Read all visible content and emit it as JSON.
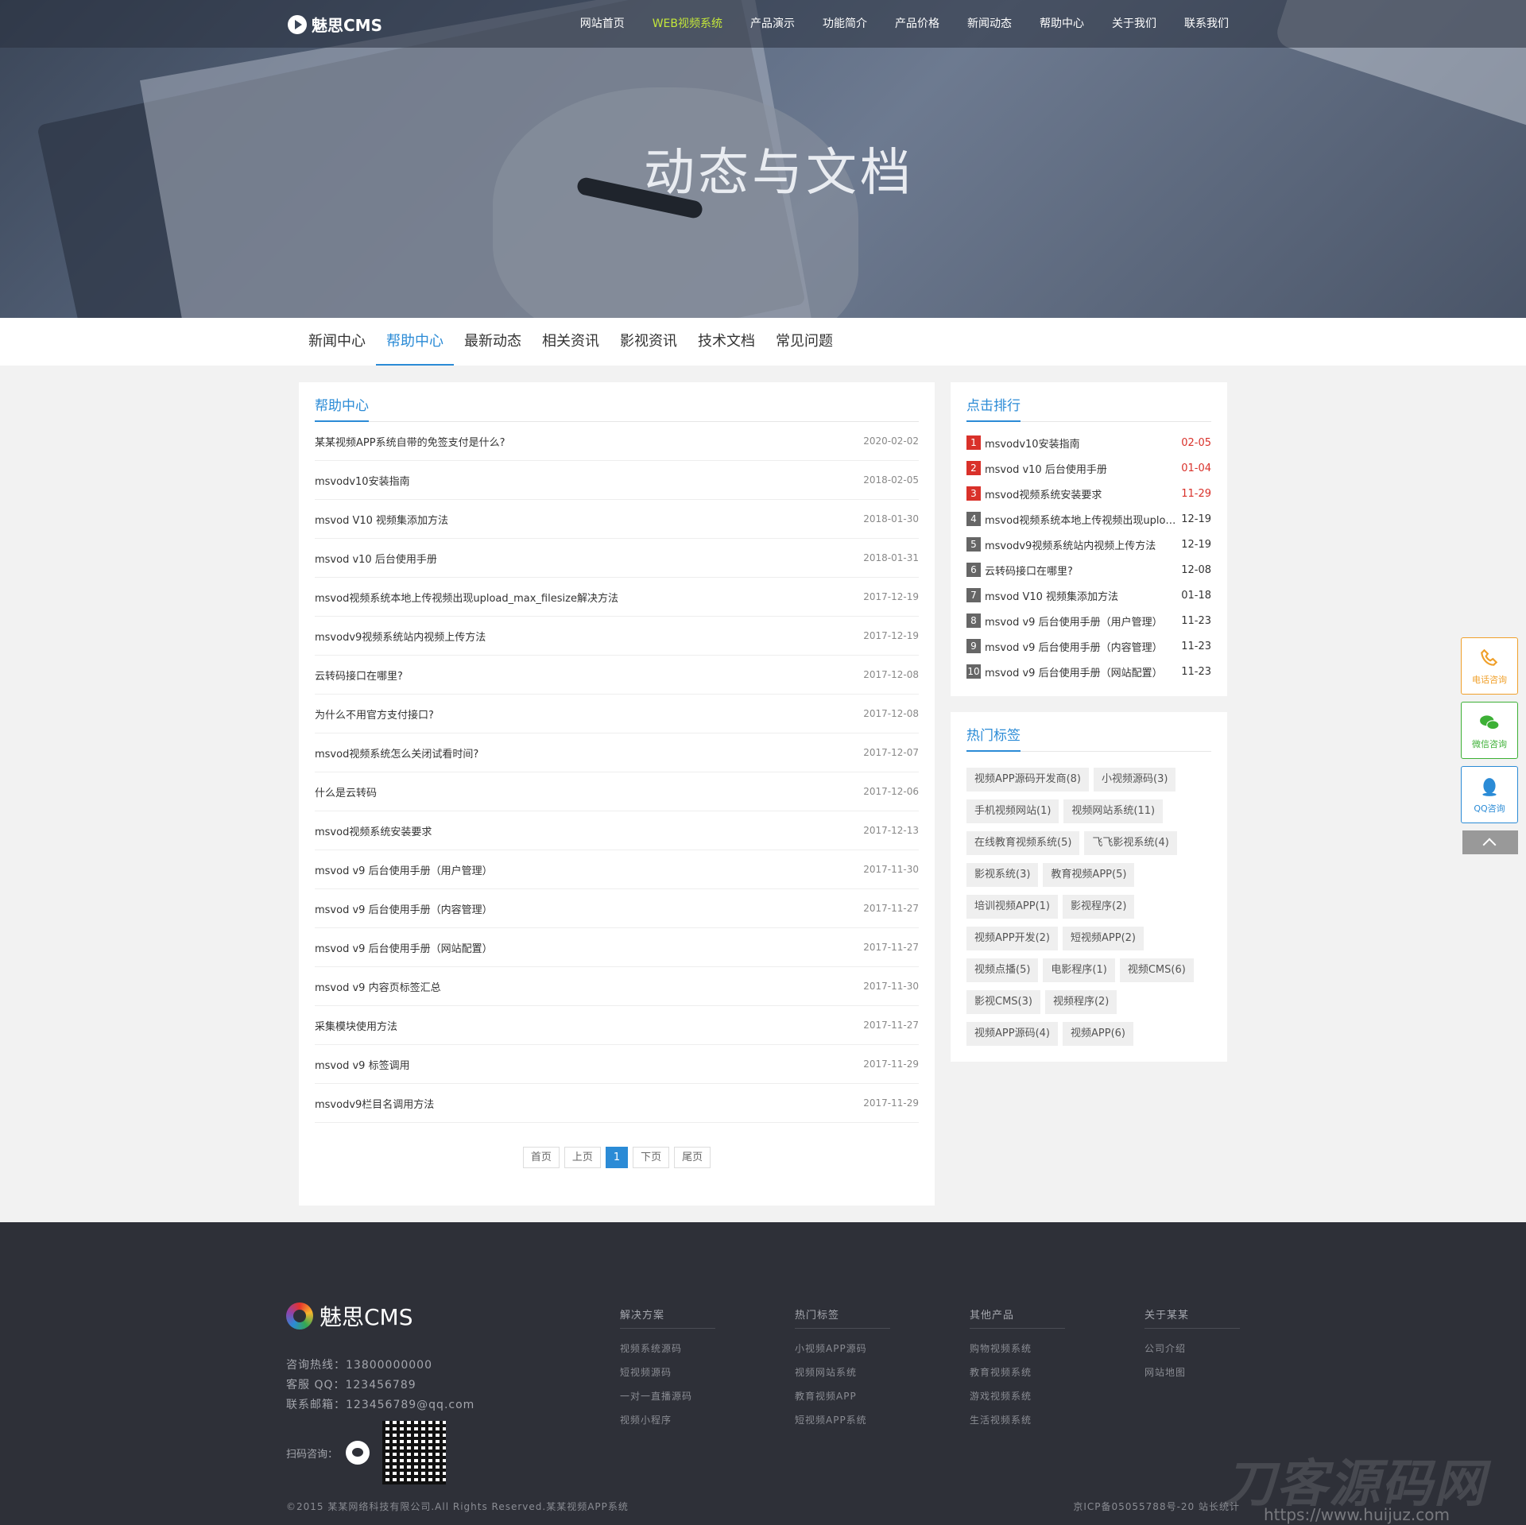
{
  "header": {
    "logo": "魅思CMS",
    "nav": [
      {
        "label": "网站首页",
        "active": false
      },
      {
        "label": "WEB视频系统",
        "active": true
      },
      {
        "label": "产品演示",
        "active": false
      },
      {
        "label": "功能简介",
        "active": false
      },
      {
        "label": "产品价格",
        "active": false
      },
      {
        "label": "新闻动态",
        "active": false
      },
      {
        "label": "帮助中心",
        "active": false
      },
      {
        "label": "关于我们",
        "active": false
      },
      {
        "label": "联系我们",
        "active": false
      }
    ],
    "banner_title": "动态与文档"
  },
  "tabs": [
    {
      "label": "新闻中心",
      "active": false
    },
    {
      "label": "帮助中心",
      "active": true
    },
    {
      "label": "最新动态",
      "active": false
    },
    {
      "label": "相关资讯",
      "active": false
    },
    {
      "label": "影视资讯",
      "active": false
    },
    {
      "label": "技术文档",
      "active": false
    },
    {
      "label": "常见问题",
      "active": false
    }
  ],
  "main": {
    "title": "帮助中心",
    "items": [
      {
        "title": "某某视频APP系统自带的免签支付是什么?",
        "date": "2020-02-02"
      },
      {
        "title": "msvodv10安装指南",
        "date": "2018-02-05"
      },
      {
        "title": "msvod V10 视频集添加方法",
        "date": "2018-01-30"
      },
      {
        "title": "msvod v10 后台使用手册",
        "date": "2018-01-31"
      },
      {
        "title": "msvod视频系统本地上传视频出现upload_max_filesize解决方法",
        "date": "2017-12-19"
      },
      {
        "title": "msvodv9视频系统站内视频上传方法",
        "date": "2017-12-19"
      },
      {
        "title": "云转码接口在哪里?",
        "date": "2017-12-08"
      },
      {
        "title": "为什么不用官方支付接口?",
        "date": "2017-12-08"
      },
      {
        "title": "msvod视频系统怎么关闭试看时间?",
        "date": "2017-12-07"
      },
      {
        "title": "什么是云转码",
        "date": "2017-12-06"
      },
      {
        "title": "msvod视频系统安装要求",
        "date": "2017-12-13"
      },
      {
        "title": "msvod v9 后台使用手册（用户管理）",
        "date": "2017-11-30"
      },
      {
        "title": "msvod v9 后台使用手册（内容管理）",
        "date": "2017-11-27"
      },
      {
        "title": "msvod v9 后台使用手册（网站配置）",
        "date": "2017-11-27"
      },
      {
        "title": "msvod v9 内容页标签汇总",
        "date": "2017-11-30"
      },
      {
        "title": "采集模块使用方法",
        "date": "2017-11-27"
      },
      {
        "title": "msvod v9 标签调用",
        "date": "2017-11-29"
      },
      {
        "title": "msvodv9栏目名调用方法",
        "date": "2017-11-29"
      }
    ],
    "pager": {
      "first": "首页",
      "prev": "上页",
      "current": "1",
      "next": "下页",
      "last": "尾页"
    }
  },
  "rank": {
    "title": "点击排行",
    "items": [
      {
        "no": "1",
        "title": "msvodv10安装指南",
        "date": "02-05",
        "hot": true
      },
      {
        "no": "2",
        "title": "msvod v10 后台使用手册",
        "date": "01-04",
        "hot": true
      },
      {
        "no": "3",
        "title": "msvod视频系统安装要求",
        "date": "11-29",
        "hot": true
      },
      {
        "no": "4",
        "title": "msvod视频系统本地上传视频出现upload_max_filesize解决方法",
        "date": "12-19",
        "hot": false
      },
      {
        "no": "5",
        "title": "msvodv9视频系统站内视频上传方法",
        "date": "12-19",
        "hot": false
      },
      {
        "no": "6",
        "title": "云转码接口在哪里?",
        "date": "12-08",
        "hot": false
      },
      {
        "no": "7",
        "title": "msvod V10 视频集添加方法",
        "date": "01-18",
        "hot": false
      },
      {
        "no": "8",
        "title": "msvod v9 后台使用手册（用户管理）",
        "date": "11-23",
        "hot": false
      },
      {
        "no": "9",
        "title": "msvod v9 后台使用手册（内容管理）",
        "date": "11-23",
        "hot": false
      },
      {
        "no": "10",
        "title": "msvod v9 后台使用手册（网站配置）",
        "date": "11-23",
        "hot": false
      }
    ]
  },
  "tags": {
    "title": "热门标签",
    "items": [
      "视频APP源码开发商(8)",
      "小视频源码(3)",
      "手机视频网站(1)",
      "视频网站系统(11)",
      "在线教育视频系统(5)",
      "飞飞影视系统(4)",
      "影视系统(3)",
      "教育视频APP(5)",
      "培训视频APP(1)",
      "影视程序(2)",
      "视频APP开发(2)",
      "短视频APP(2)",
      "视频点播(5)",
      "电影程序(1)",
      "视频CMS(6)",
      "影视CMS(3)",
      "视频程序(2)",
      "视频APP源码(4)",
      "视频APP(6)"
    ]
  },
  "float": {
    "tel": "电话咨询",
    "wechat": "微信咨询",
    "qq": "QQ咨询"
  },
  "footer": {
    "logo": "魅思CMS",
    "hotline": "咨询热线：13800000000",
    "qq": "客服 QQ：123456789",
    "email": "联系邮箱：123456789@qq.com",
    "scan": "扫码咨询：",
    "columns": [
      {
        "title": "解决方案",
        "items": [
          "视频系统源码",
          "短视频源码",
          "一对一直播源码",
          "视频小程序"
        ]
      },
      {
        "title": "热门标签",
        "items": [
          "小视频APP源码",
          "视频网站系统",
          "教育视频APP",
          "短视频APP系统"
        ]
      },
      {
        "title": "其他产品",
        "items": [
          "购物视频系统",
          "教育视频系统",
          "游戏视频系统",
          "生活视频系统"
        ]
      },
      {
        "title": "关于某某",
        "items": [
          "公司介绍",
          "网站地图"
        ]
      }
    ],
    "copyright": "©2015 某某网络科技有限公司.All Rights Reserved.某某视频APP系统",
    "icp": "京ICP备05055788号-20  站长统计"
  },
  "watermark": {
    "brand": "刀客源码网",
    "url": "https://www.huijuz.com"
  },
  "colors": {
    "accent": "#2b8bd6",
    "hot": "#d9312a",
    "nav_active": "#c3e63a",
    "footer_bg": "#2e3038"
  }
}
